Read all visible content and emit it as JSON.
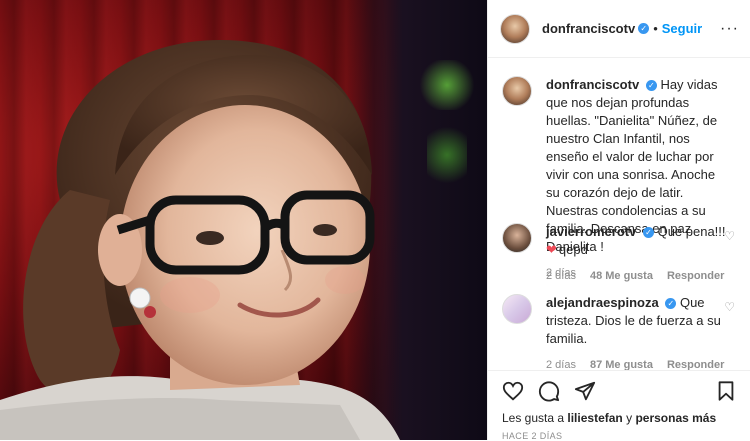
{
  "post": {
    "header": {
      "username": "donfranciscotv",
      "follow_label": "Seguir",
      "more_label": "···",
      "separator": "•"
    },
    "caption": {
      "username": "donfranciscotv",
      "text": "Hay vidas que nos dejan profundas huellas. \"Danielita\" Núñez, de nuestro Clan Infantil, nos enseño el valor de luchar por vivir con una sonrisa. Anoche su corazón dejo de latir. Nuestras condolencias a su familia. Descansa en paz Danielita !",
      "time": "2 días"
    },
    "comments": [
      {
        "username": "javierromerotv",
        "text": "Que pena!!!",
        "second_line": "qepd",
        "time": "2 días",
        "likes": "48 Me gusta",
        "reply_label": "Responder"
      },
      {
        "username": "alejandraespinoza",
        "text": "Que tristeza. Dios le de fuerza a su familia.",
        "time": "2 días",
        "likes": "87 Me gusta",
        "reply_label": "Responder"
      }
    ],
    "likes_prefix": "Les gusta a",
    "likes_user": "liliestefan",
    "likes_middle": "y",
    "likes_suffix": "personas más",
    "posted_time": "HACE 2 DÍAS"
  },
  "colors": {
    "link_blue": "#0095f6",
    "verified_blue": "#3897f0",
    "muted_gray": "#8e8e8e",
    "heart_red": "#ed4956"
  }
}
